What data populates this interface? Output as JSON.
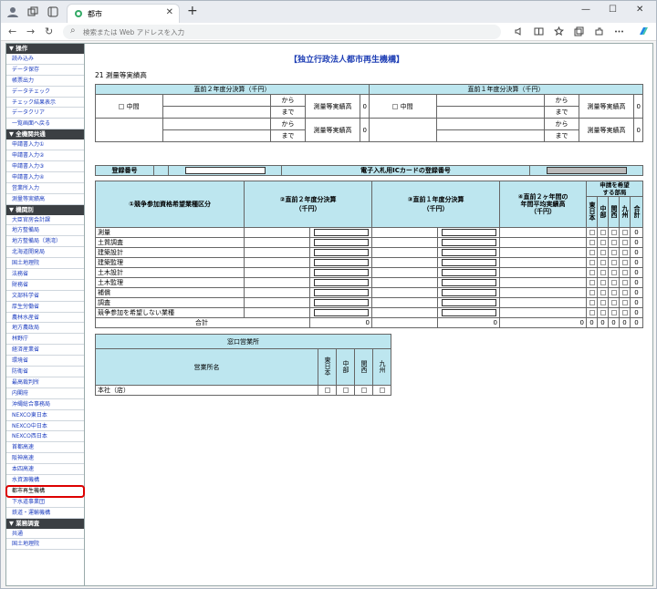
{
  "browser": {
    "tab_title": "都市",
    "address_placeholder": "検索または Web アドレスを入力",
    "new_tab": "+",
    "close_tab": "✕",
    "win_min": "—",
    "win_max": "☐",
    "win_close": "✕"
  },
  "sidebar": {
    "sections": [
      {
        "label": "▼ 操作",
        "items": [
          "読み込み",
          "データ保存",
          "帳票出力",
          "データチェック",
          "チェック結果表示",
          "データクリア",
          "一覧画面へ戻る"
        ]
      },
      {
        "label": "▼ 全機関共通",
        "items": [
          "申請書入力①",
          "申請書入力②",
          "申請書入力③",
          "申請書入力④",
          "営業所入力",
          "測量等実績高"
        ]
      },
      {
        "label": "▼ 機関別",
        "items": [
          "大臣官房会計課",
          "地方整備局",
          "地方整備局（港湾）",
          "北海道開発局",
          "国土地理院",
          "法務省",
          "財務省",
          "文部科学省",
          "厚生労働省",
          "農林水産省",
          "地方農政局",
          "林野庁",
          "経済産業省",
          "環境省",
          "防衛省",
          "最高裁判所",
          "内閣府",
          "沖縄総合事務局",
          "NEXCO東日本",
          "NEXCO中日本",
          "NEXCO西日本",
          "首都高速",
          "阪神高速",
          "本四高速",
          "水資源機構",
          "都市再生機構",
          "下水道事業団",
          "鉄道・運輸機構"
        ]
      },
      {
        "label": "▼ 業務調査",
        "items": [
          "共通",
          "国土地理院"
        ]
      }
    ],
    "highlighted": "都市再生機構"
  },
  "page": {
    "title": "【独立行政法人都市再生機構】",
    "section": "21 測量等実績高"
  },
  "settlement": {
    "prev2_header": "直前２年度分決算（千円）",
    "prev1_header": "直前１年度分決算（千円）",
    "interim_label": "中間",
    "from_label": "から",
    "to_label": "まで",
    "result_label": "測量等実績高",
    "value": "0"
  },
  "registration": {
    "reg_label": "登録番号",
    "ic_label": "電子入札用ICカードの登録番号"
  },
  "category_table": {
    "headers": {
      "category": "①競争参加資格希望業種区分",
      "prev2": "②直前２年度分決算\n（千円）",
      "prev1": "③直前１年度分決算\n（千円）",
      "avg": "④直前２ヶ年間の\n年間平均実績高\n（千円）",
      "apply": "申請を希望\nする部局",
      "dept_east": "東日本",
      "dept_central": "中部",
      "dept_kansai": "関西",
      "dept_kyushu": "九州",
      "dept_total": "合計"
    },
    "rows": [
      {
        "name": "測量",
        "total": "0"
      },
      {
        "name": "土質調査",
        "total": "0"
      },
      {
        "name": "建築設計",
        "total": "0"
      },
      {
        "name": "建築監理",
        "total": "0"
      },
      {
        "name": "土木設計",
        "total": "0"
      },
      {
        "name": "土木監理",
        "total": "0"
      },
      {
        "name": "補償",
        "total": "0"
      },
      {
        "name": "調査",
        "total": "0"
      },
      {
        "name": "競争参加を希望しない業種",
        "total": "0"
      }
    ],
    "sum_row": {
      "label": "合計",
      "prev2": "0",
      "prev1": "0",
      "avg": "0",
      "east": "0",
      "central": "0",
      "kansai": "0",
      "kyushu": "0",
      "total": "0"
    }
  },
  "office_table": {
    "title": "窓口営業所",
    "office_header": "営業所名",
    "depts": [
      "東日本",
      "中部",
      "関西",
      "九州"
    ],
    "rows": [
      {
        "name": "本社（店）"
      }
    ]
  }
}
